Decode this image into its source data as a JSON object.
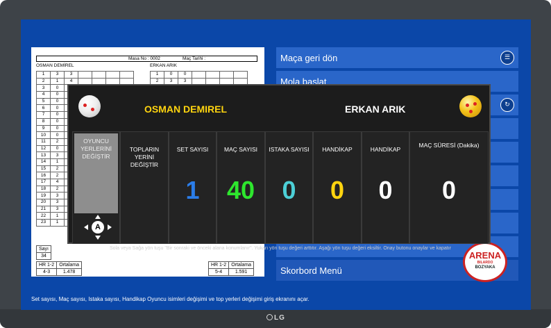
{
  "device": {
    "brand": "LG"
  },
  "scoresheet": {
    "match_no_label": "Masa No : 0002",
    "date_label": "Maç Tarihi :",
    "player1": "OSMAN DEMİREL",
    "player2": "ERKAN ARIK",
    "left_rows": [
      [
        "1",
        "3",
        "3"
      ],
      [
        "2",
        "1",
        "4"
      ],
      [
        "3",
        "0",
        ""
      ],
      [
        "4",
        "0",
        ""
      ],
      [
        "5",
        "0",
        ""
      ],
      [
        "6",
        "0",
        ""
      ],
      [
        "7",
        "0",
        ""
      ],
      [
        "8",
        "0",
        ""
      ],
      [
        "9",
        "0",
        ""
      ],
      [
        "10",
        "0",
        ""
      ],
      [
        "11",
        "2",
        ""
      ],
      [
        "12",
        "0",
        ""
      ],
      [
        "13",
        "3",
        ""
      ],
      [
        "14",
        "1",
        ""
      ],
      [
        "15",
        "2",
        ""
      ],
      [
        "16",
        "2",
        ""
      ],
      [
        "17",
        "4",
        ""
      ],
      [
        "18",
        "2",
        ""
      ],
      [
        "19",
        "3",
        ""
      ],
      [
        "20",
        "3",
        ""
      ],
      [
        "21",
        "3",
        ""
      ],
      [
        "22",
        "1",
        ""
      ],
      [
        "23",
        "1",
        ""
      ]
    ],
    "right_rows": [
      [
        "1",
        "0",
        "0"
      ],
      [
        "2",
        "3",
        "3"
      ]
    ],
    "sayi_label": "Sayı",
    "sayi_value": "34",
    "hr_label": "HR 1-2",
    "ortalama_label": "Ortalama",
    "left_hr": "4-3",
    "left_avg": "1.478",
    "right_hr": "5-4",
    "right_avg": "1.591"
  },
  "menu": {
    "items": [
      "Maça geri dön",
      "Mola başlat",
      "Skorbord Menü"
    ]
  },
  "promo": {
    "line1": "ARENA",
    "line2": "BILARDO",
    "line3": "BOZYAKA"
  },
  "bottom_hint": "Set sayısı, Maç sayısı, Istaka sayısı, Handikap Oyuncu isimleri değişimi ve top yerleri değişimi giriş ekranını açar.",
  "overlay": {
    "player1_name": "OSMAN DEMIREL",
    "player2_name": "ERKAN ARIK",
    "columns": [
      {
        "label": "OYUNCU YERLERİNİ DEĞİŞTİR",
        "value": ""
      },
      {
        "label": "TOPLARIN YERİNİ DEĞİŞTİR",
        "value": ""
      },
      {
        "label": "SET SAYISI",
        "value": "1",
        "color": "#2b7de9"
      },
      {
        "label": "MAÇ SAYISI",
        "value": "40",
        "color": "#2ee62e"
      },
      {
        "label": "ISTAKA SAYISI",
        "value": "0",
        "color": "#4ccfd6"
      },
      {
        "label": "HANDİKAP",
        "value": "0",
        "color": "#ffd40f"
      },
      {
        "label": "HANDİKAP",
        "value": "0",
        "color": "#ffffff"
      },
      {
        "label": "MAÇ SÜRESİ (Dakika)",
        "value": "0",
        "color": "#ffffff"
      }
    ],
    "dpad_center": "A",
    "help": "Sola veya Sağa yön tuşu \"Bir sonraki ve önceki alana konumlanır\". Yukarı yön tuşu değeri arttıtır. Aşağı yön tuşu değeri eksiltir. Onay butonu onaylar ve kapatır"
  }
}
